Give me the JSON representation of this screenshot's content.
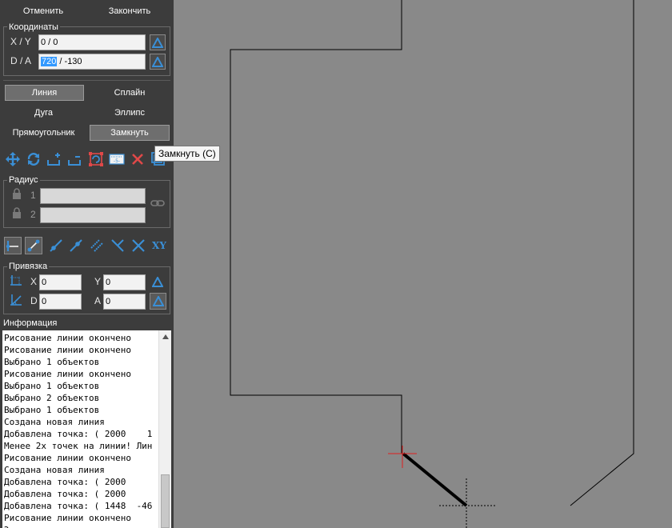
{
  "top_buttons": {
    "cancel": "Отменить",
    "finish": "Закончить"
  },
  "coords": {
    "title": "Координаты",
    "xy_label": "X / Y",
    "xy_value": "0 / 0",
    "da_label": "D / A",
    "d_selected": "720",
    "a_value": " / -130"
  },
  "modes": {
    "line": "Линия",
    "spline": "Сплайн",
    "arc": "Дуга",
    "ellipse": "Эллипс",
    "rect": "Прямоугольник",
    "close": "Замкнуть"
  },
  "tooltip": "Замкнуть (C)",
  "radius": {
    "title": "Радиус",
    "r1": "1",
    "r2": "2"
  },
  "xy_icon_text": "XY",
  "snap": {
    "title": "Привязка",
    "x_label": "X",
    "x_value": "0",
    "y_label": "Y",
    "y_value": "0",
    "d_label": "D",
    "d_value": "0",
    "a_label": "A",
    "a_value": "0"
  },
  "info": {
    "title": "Информация",
    "lines": [
      "Рисование линии окончено",
      "Рисование линии окончено",
      "Выбрано 1 объектов",
      "Рисование линии окончено",
      "Выбрано 1 объектов",
      "Выбрано 2 объектов",
      "Выбрано 1 объектов",
      "Создана новая линия",
      "Добавлена точка: ( 2000    1",
      "Менее 2х точек на линии! Лин",
      "Рисование линии окончено",
      "Создана новая линия",
      "Добавлена точка: ( 2000",
      "Добавлена точка: ( 2000",
      "Добавлена точка: ( 1448  -46",
      "Рисование линии окончено",
      "Э"
    ]
  },
  "colors": {
    "accent": "#3a8fd6",
    "danger": "#e04848",
    "panel": "#3c3c3c",
    "canvas": "#898989"
  }
}
